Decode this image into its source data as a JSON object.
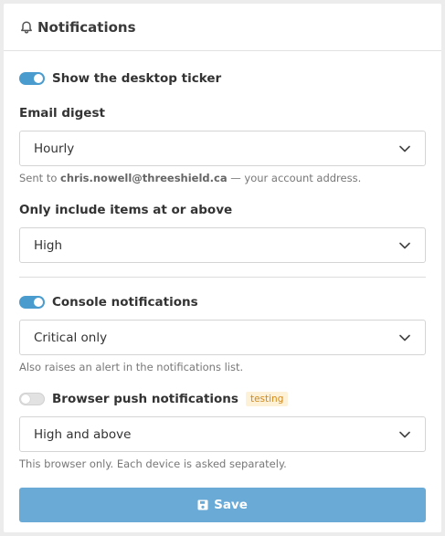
{
  "panel": {
    "title": "Notifications",
    "icon": "bell-icon"
  },
  "desktop_ticker": {
    "label": "Show the desktop ticker",
    "enabled": true
  },
  "email_digest": {
    "label": "Email digest",
    "value": "Hourly",
    "hint_prefix": "Sent to",
    "email": "chris.nowell@threeshield.ca",
    "hint_suffix": "— your account address."
  },
  "min_level": {
    "label": "Only include items at or above",
    "value": "High"
  },
  "console": {
    "label": "Console notifications",
    "enabled": true,
    "value": "Critical only",
    "hint": "Also raises an alert in the notifications list."
  },
  "browser_push": {
    "label": "Browser push notifications",
    "enabled": false,
    "badge": "testing",
    "value": "High and above",
    "hint": "This browser only. Each device is asked separately."
  },
  "save": {
    "label": "Save",
    "icon": "save-disk-icon"
  },
  "colors": {
    "accent": "#4a9ccf",
    "button": "#6aaad6",
    "badge_text": "#d08a1a",
    "badge_bg": "#fdf1d8"
  }
}
